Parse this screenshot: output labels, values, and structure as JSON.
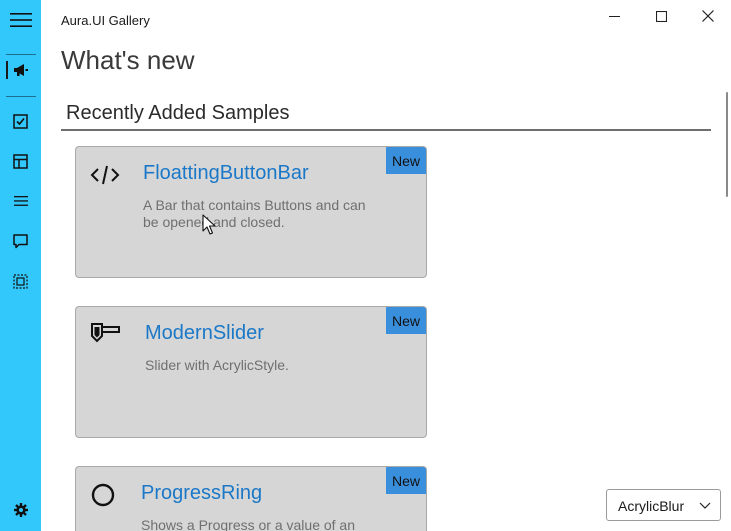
{
  "window": {
    "title": "Aura.UI Gallery",
    "minimize_label": "Minimize",
    "maximize_label": "Maximize",
    "close_label": "Close"
  },
  "sidebar": {
    "items": [
      {
        "id": "menu",
        "icon": "hamburger-menu-icon"
      },
      {
        "id": "whats-new",
        "icon": "megaphone-icon",
        "selected": true
      },
      {
        "id": "checkbox",
        "icon": "checkbox-icon"
      },
      {
        "id": "layout",
        "icon": "layout-icon"
      },
      {
        "id": "list",
        "icon": "list-icon"
      },
      {
        "id": "dialog",
        "icon": "message-icon"
      },
      {
        "id": "window",
        "icon": "window-frame-icon"
      },
      {
        "id": "settings",
        "icon": "gear-icon"
      }
    ],
    "accent_color": "#33c8fb"
  },
  "page": {
    "title": "What's new",
    "section_title": "Recently Added Samples"
  },
  "cards": [
    {
      "title": "FloattingButtonBar",
      "description": "A Bar that contains Buttons and can be opened and closed.",
      "badge": "New",
      "icon": "code-icon"
    },
    {
      "title": "ModernSlider",
      "description": "Slider with AcrylicStyle.",
      "badge": "New",
      "icon": "slider-icon"
    },
    {
      "title": "ProgressRing",
      "description": "Shows a Progress or a value of an",
      "badge": "New",
      "icon": "progress-ring-icon"
    }
  ],
  "theme_dropdown": {
    "selected": "AcrylicBlur"
  },
  "colors": {
    "card_title": "#1b78c8",
    "badge": "#3a8fdd",
    "card_bg": "#d6d6d6"
  }
}
